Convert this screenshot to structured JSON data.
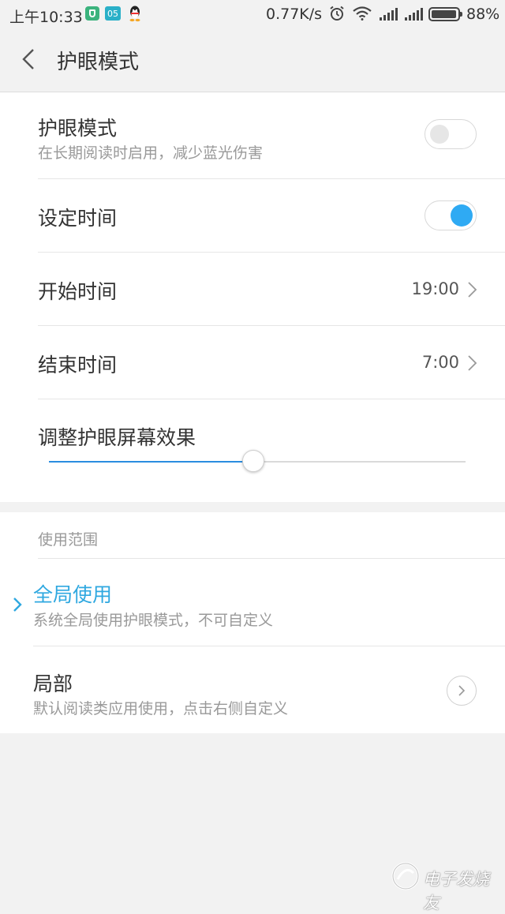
{
  "status_bar": {
    "time": "上午10:33",
    "calendar_badge": "05",
    "net_speed": "0.77K/s",
    "battery": "88%",
    "icons": [
      "shield-icon",
      "calendar-icon",
      "qq-icon",
      "alarm-icon",
      "wifi-icon",
      "signal-icon",
      "signal-icon",
      "battery-icon"
    ]
  },
  "header": {
    "title": "护眼模式",
    "back_icon": "chevron-left-icon"
  },
  "settings": {
    "eye_mode": {
      "title": "护眼模式",
      "subtitle": "在长期阅读时启用，减少蓝光伤害",
      "enabled": false
    },
    "schedule": {
      "title": "设定时间",
      "enabled": true
    },
    "start_time": {
      "title": "开始时间",
      "value": "19:00"
    },
    "end_time": {
      "title": "结束时间",
      "value": "7:00"
    },
    "effect": {
      "title": "调整护眼屏幕效果",
      "level_fraction": 0.49
    }
  },
  "scope": {
    "section_label": "使用范围",
    "options": [
      {
        "title": "全局使用",
        "subtitle": "系统全局使用护眼模式，不可自定义",
        "selected": true
      },
      {
        "title": "局部",
        "subtitle": "默认阅读类应用使用，点击右侧自定义",
        "selected": false
      }
    ]
  },
  "colors": {
    "accent": "#2faaf3",
    "selected_text": "#2fa8e0",
    "background": "#f2f2f2"
  },
  "watermark": {
    "text": "电子发烧友"
  }
}
